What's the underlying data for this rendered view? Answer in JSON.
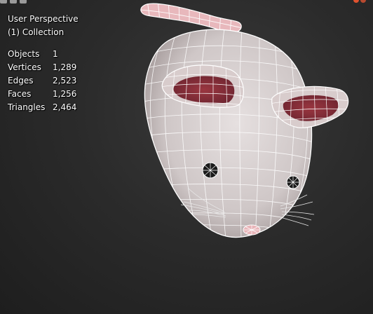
{
  "viewport": {
    "view_name": "User Perspective",
    "collection": "(1) Collection"
  },
  "statistics": [
    {
      "label": "Objects",
      "value": "1"
    },
    {
      "label": "Vertices",
      "value": "1,289"
    },
    {
      "label": "Edges",
      "value": "2,523"
    },
    {
      "label": "Faces",
      "value": "1,256"
    },
    {
      "label": "Triangles",
      "value": "2,464"
    }
  ],
  "colors": {
    "mesh_body": "#d8d2d2",
    "ear_inner": "#8a2e35",
    "tail": "#e8b8bc",
    "wire": "#ffffff",
    "gizmo_x": "#e0522f",
    "gizmo_y": "#6a9a2f"
  }
}
